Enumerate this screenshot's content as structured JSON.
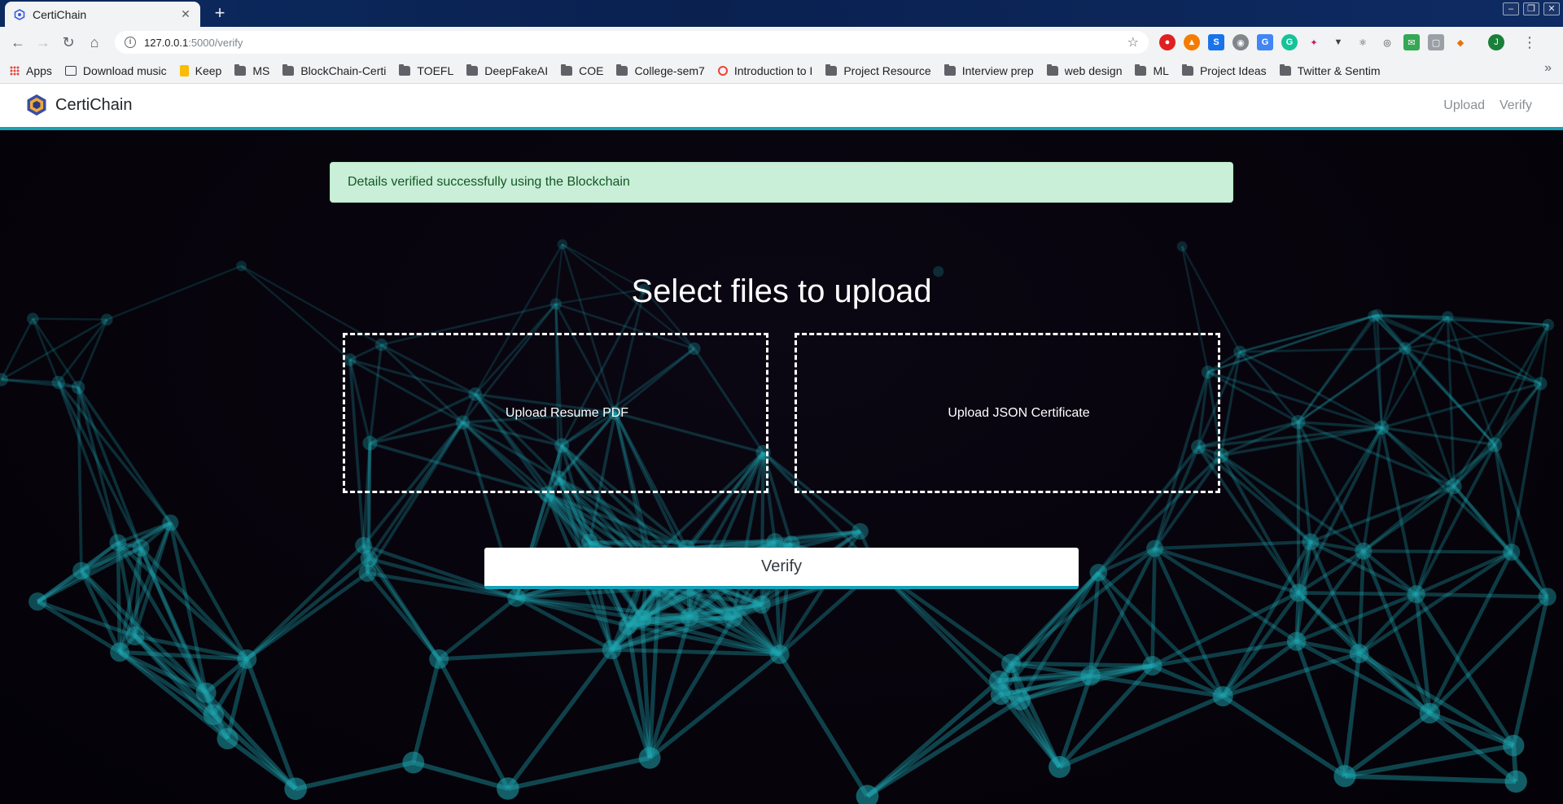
{
  "browser": {
    "tab": {
      "title": "CertiChain"
    },
    "url": {
      "host": "127.0.0.1",
      "path": ":5000/verify"
    },
    "bookmarks": [
      {
        "label": "Apps",
        "icon": "apps-icon"
      },
      {
        "label": "Download music",
        "icon": "music-icon"
      },
      {
        "label": "Keep",
        "icon": "keep-icon"
      },
      {
        "label": "MS",
        "icon": "folder-icon"
      },
      {
        "label": "BlockChain-Certi",
        "icon": "folder-icon"
      },
      {
        "label": "TOEFL",
        "icon": "folder-icon"
      },
      {
        "label": "DeepFakeAI",
        "icon": "folder-icon"
      },
      {
        "label": "COE",
        "icon": "folder-icon"
      },
      {
        "label": "College-sem7",
        "icon": "folder-icon"
      },
      {
        "label": "Introduction to I",
        "icon": "site-icon"
      },
      {
        "label": "Project Resource",
        "icon": "folder-icon"
      },
      {
        "label": "Interview prep",
        "icon": "folder-icon"
      },
      {
        "label": "web design",
        "icon": "folder-icon"
      },
      {
        "label": "ML",
        "icon": "folder-icon"
      },
      {
        "label": "Project Ideas",
        "icon": "folder-icon"
      },
      {
        "label": "Twitter & Sentim",
        "icon": "folder-icon"
      }
    ],
    "profile_initial": "J"
  },
  "app": {
    "brand": "CertiChain",
    "nav": {
      "upload": "Upload",
      "verify": "Verify"
    },
    "alert": "Details verified successfully using the Blockchain",
    "heading": "Select files to upload",
    "dropzones": {
      "resume": "Upload Resume PDF",
      "json": "Upload JSON Certificate"
    },
    "verify_button": "Verify"
  },
  "colors": {
    "accent": "#17a2b8",
    "alert_bg": "#c9efd8",
    "alert_text": "#155724",
    "network_line": "#1ea6b0"
  }
}
